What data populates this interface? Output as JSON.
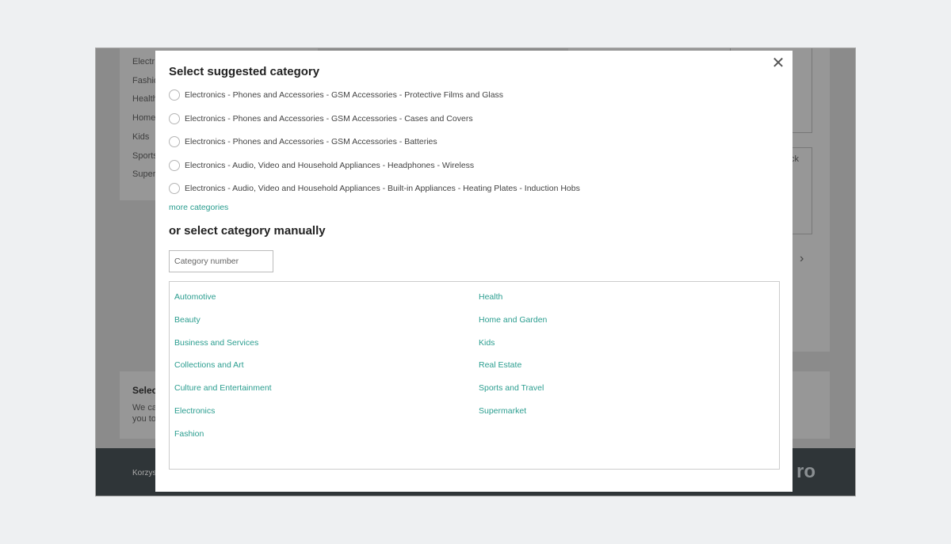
{
  "background": {
    "sidebar_items": [
      "Electr",
      "Fashio",
      "Health",
      "Home",
      "Kids",
      "Sports",
      "Super"
    ],
    "select_heading": "Selec",
    "select_text": [
      "We ca",
      "you to"
    ],
    "right_card_text": "ck",
    "footer_text": "Korzys",
    "footer_logo": "ro",
    "next_icon": "chevron-right-icon"
  },
  "modal": {
    "close_icon": "close-icon",
    "suggested_title": "Select suggested category",
    "suggestions": [
      "Electronics - Phones and Accessories - GSM Accessories - Protective Films and Glass",
      "Electronics - Phones and Accessories - GSM Accessories - Cases and Covers",
      "Electronics - Phones and Accessories - GSM Accessories - Batteries",
      "Electronics - Audio, Video and Household Appliances - Headphones - Wireless",
      "Electronics - Audio, Video and Household Appliances - Built-in Appliances - Heating Plates - Induction Hobs"
    ],
    "more_link": "more categories",
    "manual_title": "or select category manually",
    "category_input": {
      "value": "",
      "placeholder": "Category number"
    },
    "categories_left": [
      "Automotive",
      "Beauty",
      "Business and Services",
      "Collections and Art",
      "Culture and Entertainment",
      "Electronics",
      "Fashion"
    ],
    "categories_right": [
      "Health",
      "Home and Garden",
      "Kids",
      "Real Estate",
      "Sports and Travel",
      "Supermarket"
    ],
    "link_color": "#2a9d8f"
  }
}
